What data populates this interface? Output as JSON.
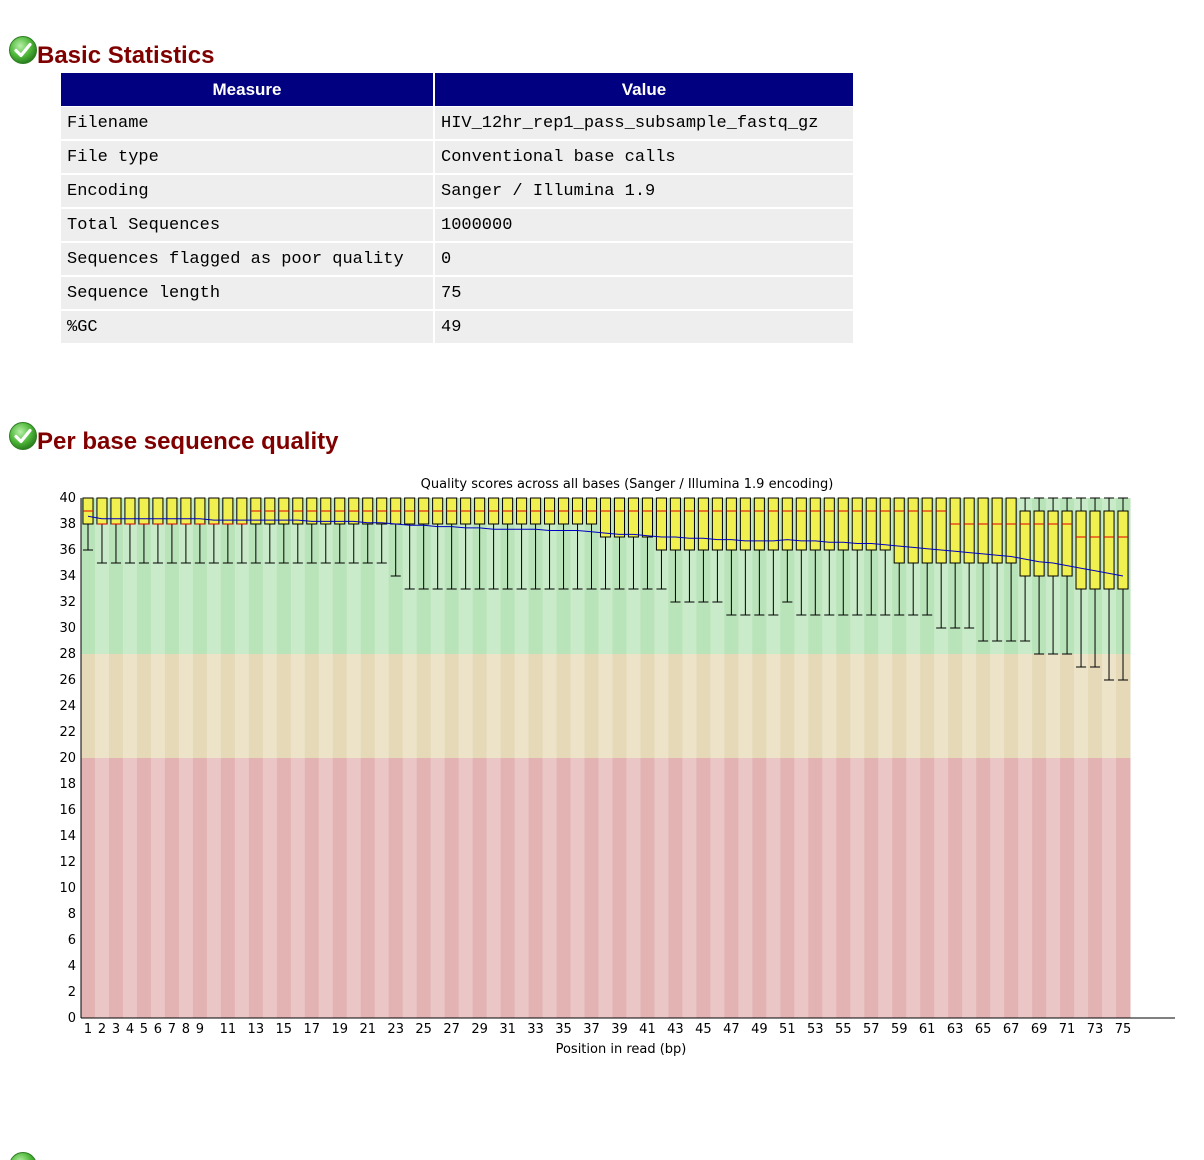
{
  "modules": {
    "basic_statistics": {
      "title": "Basic Statistics",
      "status_icon": "pass-check-icon",
      "table": {
        "headers": [
          "Measure",
          "Value"
        ],
        "rows": [
          [
            "Filename",
            "HIV_12hr_rep1_pass_subsample_fastq_gz"
          ],
          [
            "File type",
            "Conventional base calls"
          ],
          [
            "Encoding",
            "Sanger / Illumina 1.9"
          ],
          [
            "Total Sequences",
            "1000000"
          ],
          [
            "Sequences flagged as poor quality",
            "0"
          ],
          [
            "Sequence length",
            "75"
          ],
          [
            "%GC",
            "49"
          ]
        ]
      }
    },
    "per_base_quality": {
      "title": "Per base sequence quality",
      "status_icon": "pass-check-icon"
    },
    "next_module": {
      "status_icon": "pass-check-icon"
    }
  },
  "colors": {
    "title": "#800000",
    "table_header_bg": "#000080",
    "table_cell_bg": "#eeeeee",
    "zone_good": "#b9e3b9",
    "zone_good_alt": "#c9ebc9",
    "zone_ok": "#e6d9b8",
    "zone_ok_alt": "#ece3c8",
    "zone_bad": "#e3b3b3",
    "zone_bad_alt": "#ebc6c6",
    "box_fill": "#f0f050",
    "median_line": "#e00000",
    "mean_line": "#0000c0"
  },
  "chart_data": {
    "type": "boxplot",
    "title": "Quality scores across all bases (Sanger / Illumina 1.9 encoding)",
    "xlabel": "Position in read (bp)",
    "ylabel": "",
    "ylim": [
      0,
      40
    ],
    "yticks": [
      0,
      2,
      4,
      6,
      8,
      10,
      12,
      14,
      16,
      18,
      20,
      22,
      24,
      26,
      28,
      30,
      32,
      34,
      36,
      38,
      40
    ],
    "x": [
      1,
      2,
      3,
      4,
      5,
      6,
      7,
      8,
      9,
      10,
      11,
      12,
      13,
      14,
      15,
      16,
      17,
      18,
      19,
      20,
      21,
      22,
      23,
      24,
      25,
      26,
      27,
      28,
      29,
      30,
      31,
      32,
      33,
      34,
      35,
      36,
      37,
      38,
      39,
      40,
      41,
      42,
      43,
      44,
      45,
      46,
      47,
      48,
      49,
      50,
      51,
      52,
      53,
      54,
      55,
      56,
      57,
      58,
      59,
      60,
      61,
      62,
      63,
      64,
      65,
      66,
      67,
      68,
      69,
      70,
      71,
      72,
      73,
      74,
      75
    ],
    "xtick_labels": [
      "1",
      "2",
      "3",
      "4",
      "5",
      "6",
      "7",
      "8",
      "9",
      "",
      "11",
      "",
      "13",
      "",
      "15",
      "",
      "17",
      "",
      "19",
      "",
      "21",
      "",
      "23",
      "",
      "25",
      "",
      "27",
      "",
      "29",
      "",
      "31",
      "",
      "33",
      "",
      "35",
      "",
      "37",
      "",
      "39",
      "",
      "41",
      "",
      "43",
      "",
      "45",
      "",
      "47",
      "",
      "49",
      "",
      "51",
      "",
      "53",
      "",
      "55",
      "",
      "57",
      "",
      "59",
      "",
      "61",
      "",
      "63",
      "",
      "65",
      "",
      "67",
      "",
      "69",
      "",
      "71",
      "",
      "73",
      "",
      "75"
    ],
    "zones": [
      {
        "name": "good",
        "from": 28,
        "to": 40
      },
      {
        "name": "acceptable",
        "from": 20,
        "to": 28
      },
      {
        "name": "poor",
        "from": 0,
        "to": 20
      }
    ],
    "series": [
      {
        "name": "median",
        "values": [
          39,
          38,
          38,
          38,
          38,
          38,
          38,
          38,
          38,
          38,
          38,
          38,
          39,
          39,
          39,
          39,
          39,
          39,
          39,
          39,
          39,
          39,
          39,
          39,
          39,
          39,
          39,
          39,
          39,
          39,
          39,
          39,
          39,
          39,
          39,
          39,
          39,
          39,
          39,
          39,
          39,
          39,
          39,
          39,
          39,
          39,
          39,
          39,
          39,
          39,
          39,
          39,
          39,
          39,
          39,
          39,
          39,
          39,
          39,
          39,
          39,
          39,
          38,
          38,
          38,
          38,
          38,
          38,
          38,
          38,
          38,
          37,
          37,
          37,
          37
        ]
      },
      {
        "name": "q1",
        "values": [
          38,
          38,
          38,
          38,
          38,
          38,
          38,
          38,
          38,
          38,
          38,
          38,
          38,
          38,
          38,
          38,
          38,
          38,
          38,
          38,
          38,
          38,
          38,
          38,
          38,
          38,
          38,
          38,
          38,
          38,
          38,
          38,
          38,
          38,
          38,
          38,
          38,
          37,
          37,
          37,
          37,
          36,
          36,
          36,
          36,
          36,
          36,
          36,
          36,
          36,
          36,
          36,
          36,
          36,
          36,
          36,
          36,
          36,
          35,
          35,
          35,
          35,
          35,
          35,
          35,
          35,
          35,
          34,
          34,
          34,
          34,
          33,
          33,
          33,
          33
        ]
      },
      {
        "name": "q3",
        "values": [
          40,
          40,
          40,
          40,
          40,
          40,
          40,
          40,
          40,
          40,
          40,
          40,
          40,
          40,
          40,
          40,
          40,
          40,
          40,
          40,
          40,
          40,
          40,
          40,
          40,
          40,
          40,
          40,
          40,
          40,
          40,
          40,
          40,
          40,
          40,
          40,
          40,
          40,
          40,
          40,
          40,
          40,
          40,
          40,
          40,
          40,
          40,
          40,
          40,
          40,
          40,
          40,
          40,
          40,
          40,
          40,
          40,
          40,
          40,
          40,
          40,
          40,
          40,
          40,
          40,
          40,
          40,
          39,
          39,
          39,
          39,
          39,
          39,
          39,
          39
        ]
      },
      {
        "name": "whisker_low",
        "values": [
          36,
          35,
          35,
          35,
          35,
          35,
          35,
          35,
          35,
          35,
          35,
          35,
          35,
          35,
          35,
          35,
          35,
          35,
          35,
          35,
          35,
          35,
          34,
          33,
          33,
          33,
          33,
          33,
          33,
          33,
          33,
          33,
          33,
          33,
          33,
          33,
          33,
          33,
          33,
          33,
          33,
          33,
          32,
          32,
          32,
          32,
          31,
          31,
          31,
          31,
          32,
          31,
          31,
          31,
          31,
          31,
          31,
          31,
          31,
          31,
          31,
          30,
          30,
          30,
          29,
          29,
          29,
          29,
          28,
          28,
          28,
          27,
          27,
          26,
          26
        ]
      },
      {
        "name": "whisker_high",
        "values": [
          40,
          40,
          40,
          40,
          40,
          40,
          40,
          40,
          40,
          40,
          40,
          40,
          40,
          40,
          40,
          40,
          40,
          40,
          40,
          40,
          40,
          40,
          40,
          40,
          40,
          40,
          40,
          40,
          40,
          40,
          40,
          40,
          40,
          40,
          40,
          40,
          40,
          40,
          40,
          40,
          40,
          40,
          40,
          40,
          40,
          40,
          40,
          40,
          40,
          40,
          40,
          40,
          40,
          40,
          40,
          40,
          40,
          40,
          40,
          40,
          40,
          40,
          40,
          40,
          40,
          40,
          40,
          40,
          40,
          40,
          40,
          40,
          40,
          40,
          40
        ]
      },
      {
        "name": "mean",
        "values": [
          38.6,
          38.4,
          38.4,
          38.4,
          38.4,
          38.4,
          38.4,
          38.4,
          38.4,
          38.3,
          38.3,
          38.3,
          38.3,
          38.3,
          38.3,
          38.3,
          38.2,
          38.2,
          38.2,
          38.2,
          38.1,
          38.1,
          38.0,
          37.9,
          37.9,
          37.8,
          37.8,
          37.7,
          37.7,
          37.6,
          37.6,
          37.6,
          37.6,
          37.5,
          37.5,
          37.5,
          37.4,
          37.3,
          37.2,
          37.2,
          37.1,
          37.0,
          37.0,
          36.9,
          36.9,
          36.8,
          36.8,
          36.7,
          36.7,
          36.7,
          36.8,
          36.7,
          36.7,
          36.6,
          36.6,
          36.5,
          36.5,
          36.4,
          36.3,
          36.2,
          36.1,
          36.0,
          35.9,
          35.8,
          35.7,
          35.6,
          35.5,
          35.3,
          35.1,
          35.0,
          34.8,
          34.6,
          34.4,
          34.2,
          34.0
        ]
      }
    ],
    "grid": false,
    "legend": "none"
  }
}
